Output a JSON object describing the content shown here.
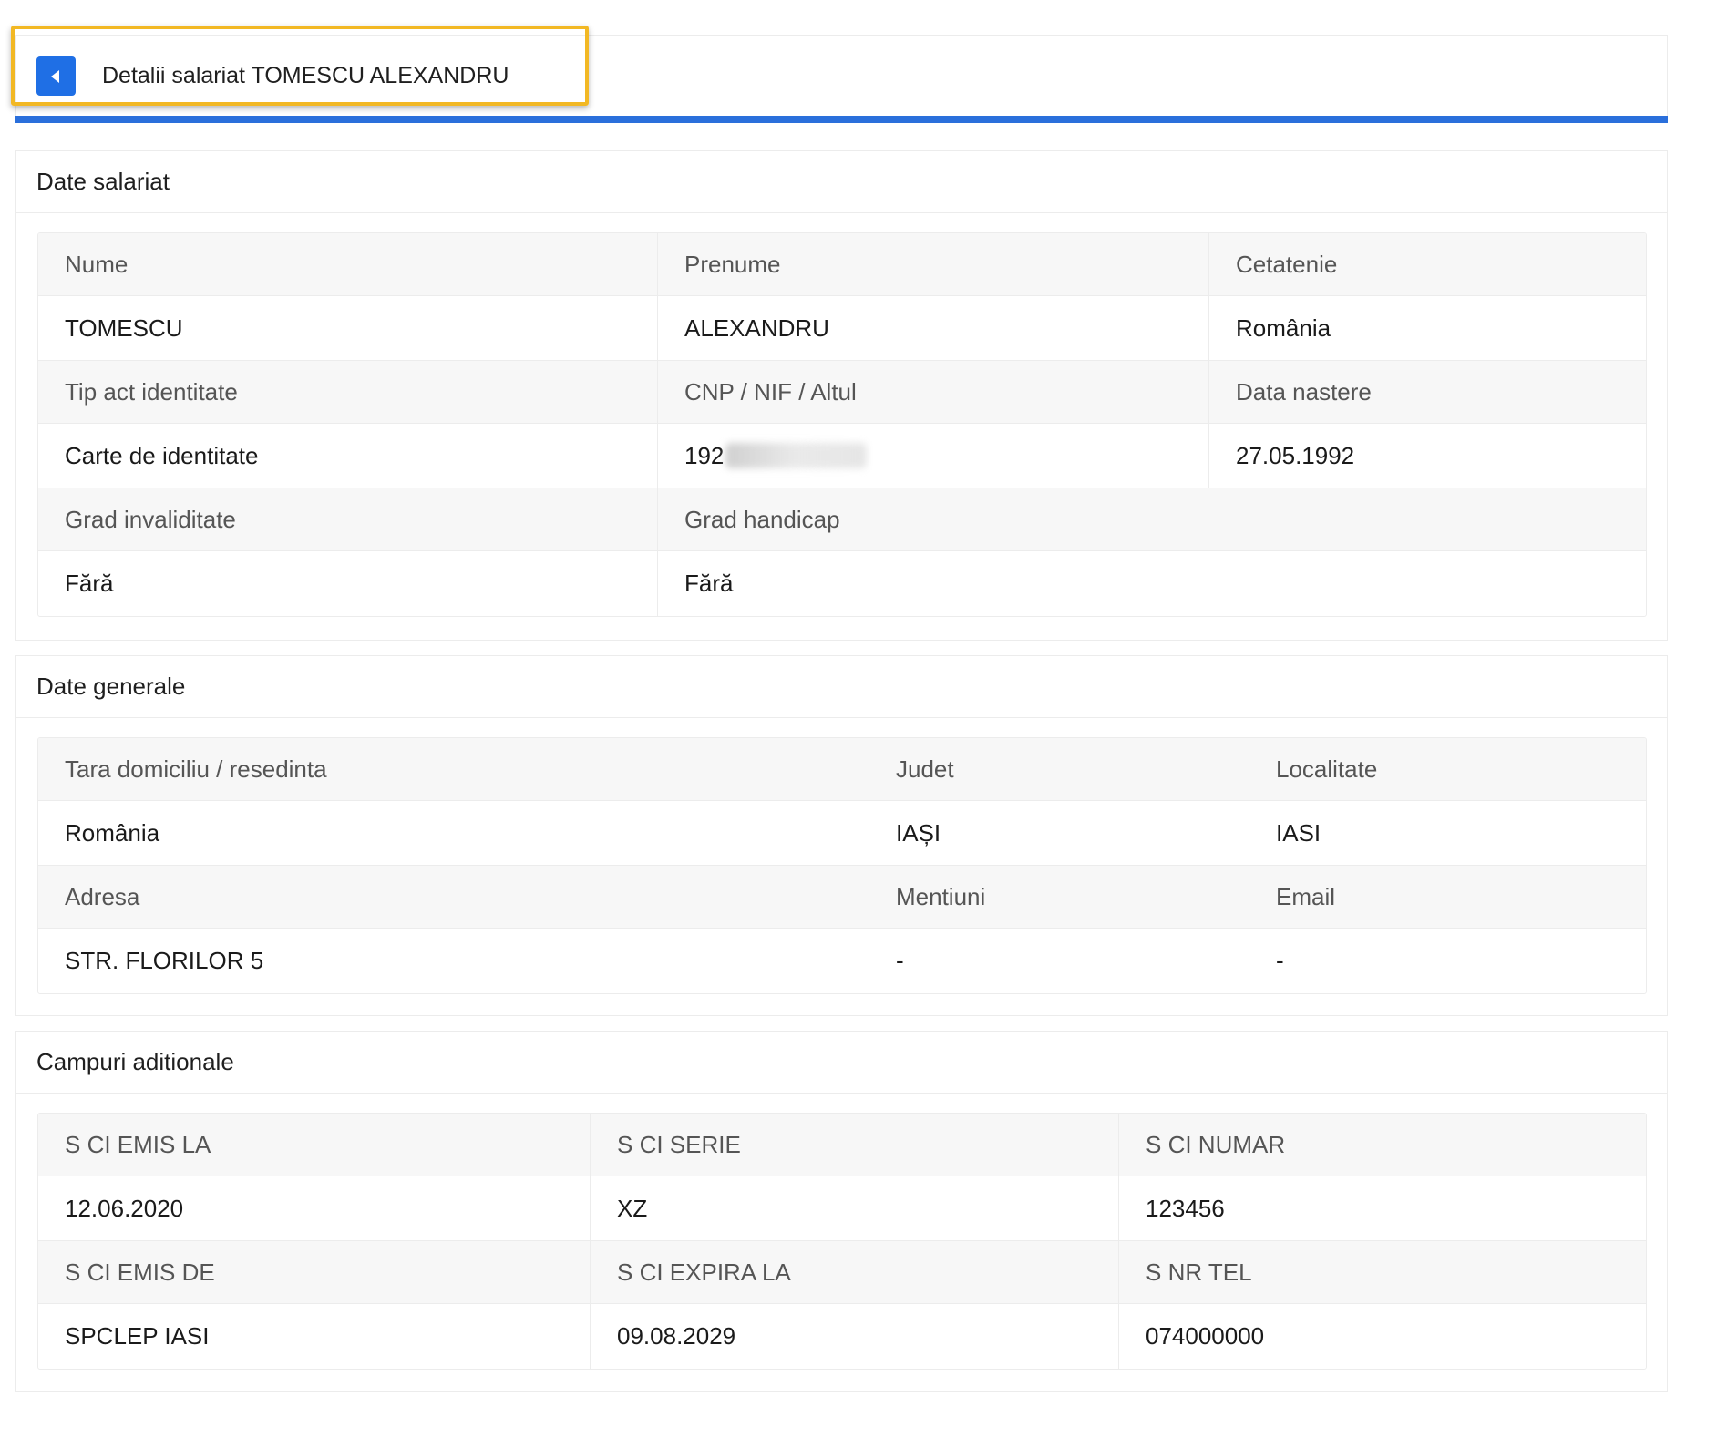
{
  "header": {
    "back_icon": "caret-left-icon",
    "title": "Detalii salariat TOMESCU ALEXANDRU",
    "accent_color": "#2a6fdb",
    "focus_color": "#f2b824"
  },
  "employee": {
    "title": "Date salariat",
    "rows": [
      {
        "labels": [
          "Nume",
          "Prenume",
          "Cetatenie"
        ],
        "values": [
          "TOMESCU",
          "ALEXANDRU",
          "România"
        ]
      },
      {
        "labels": [
          "Tip act identitate",
          "CNP / NIF / Altul",
          "Data nastere"
        ],
        "values": [
          "Carte de identitate",
          "192",
          "27.05.1992"
        ]
      },
      {
        "labels": [
          "Grad invaliditate",
          "Grad handicap",
          ""
        ],
        "values": [
          "Fără",
          "Fără",
          ""
        ]
      }
    ]
  },
  "general": {
    "title": "Date generale",
    "rows": [
      {
        "labels": [
          "Tara domiciliu / resedinta",
          "Judet",
          "Localitate"
        ],
        "values": [
          "România",
          "IAȘI",
          "IASI"
        ]
      },
      {
        "labels": [
          "Adresa",
          "Mentiuni",
          "Email"
        ],
        "values": [
          "STR. FLORILOR 5",
          "-",
          "-"
        ]
      }
    ]
  },
  "additional": {
    "title": "Campuri aditionale",
    "rows": [
      {
        "labels": [
          "S CI EMIS LA",
          "S CI SERIE",
          "S CI NUMAR"
        ],
        "values": [
          "12.06.2020",
          "XZ",
          "123456"
        ]
      },
      {
        "labels": [
          "S CI EMIS DE",
          "S CI EXPIRA LA",
          "S NR TEL"
        ],
        "values": [
          "SPCLEP IASI",
          "09.08.2029",
          "074000000"
        ]
      }
    ]
  }
}
